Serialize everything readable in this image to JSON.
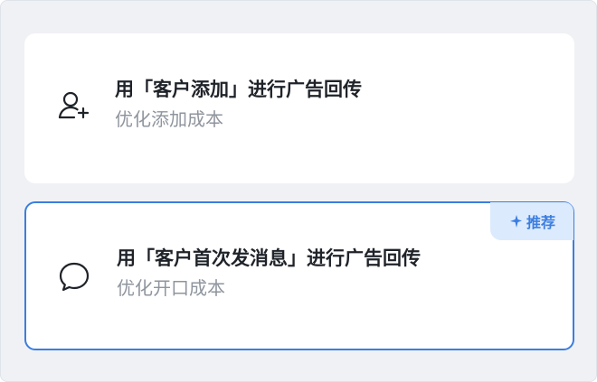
{
  "options": [
    {
      "title": "用「客户添加」进行广告回传",
      "subtitle": "优化添加成本",
      "icon": "add-user-icon"
    },
    {
      "title": "用「客户首次发消息」进行广告回传",
      "subtitle": "优化开口成本",
      "icon": "chat-bubble-icon",
      "badge": "推荐",
      "badge_icon": "sparkle-icon"
    }
  ],
  "colors": {
    "selected_border": "#3b7ee0",
    "badge_bg": "#dceafd",
    "panel_bg": "#eff1f5"
  }
}
